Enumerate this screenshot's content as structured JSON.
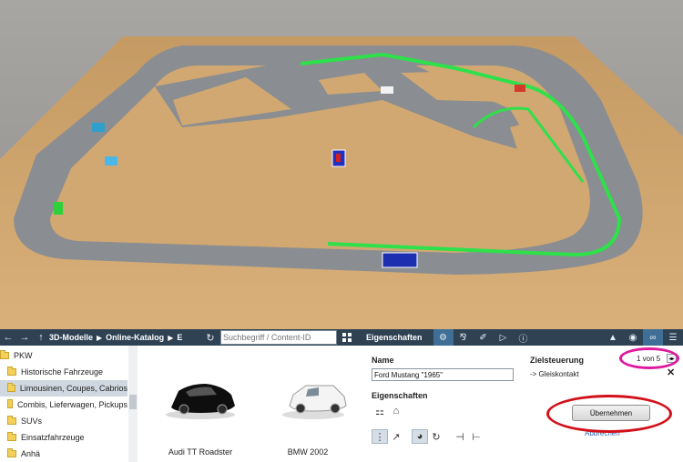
{
  "catalog": {
    "breadcrumb": [
      "3D-Modelle",
      "Online-Katalog",
      "E"
    ],
    "search_placeholder": "Suchbegriff / Content-ID",
    "tree": [
      {
        "label": "PKW",
        "selected": false
      },
      {
        "label": "Historische Fahrzeuge",
        "selected": false
      },
      {
        "label": "Limousinen, Coupes, Cabrios",
        "selected": true
      },
      {
        "label": "Combis, Lieferwagen, Pickups",
        "selected": false
      },
      {
        "label": "SUVs",
        "selected": false
      },
      {
        "label": "Einsatzfahrzeuge",
        "selected": false
      },
      {
        "label": "Anhä",
        "selected": false
      }
    ],
    "items": [
      {
        "label": "Audi TT Roadster",
        "color": "#101010"
      },
      {
        "label": "BMW 2002",
        "color": "#f2f2f2"
      }
    ]
  },
  "props": {
    "title": "Eigenschaften",
    "name_heading": "Name",
    "name_value": "Ford Mustang \"1965\"",
    "props_heading": "Eigenschaften",
    "target_heading": "Zielsteuerung",
    "target_value": "-> Gleiskontakt",
    "counter": "1 von 5",
    "apply_label": "Übernehmen",
    "cancel_label": "Abbrechen"
  },
  "annotations": {
    "ring1_color": "#e0189e",
    "ring2_color": "#d3101a"
  }
}
